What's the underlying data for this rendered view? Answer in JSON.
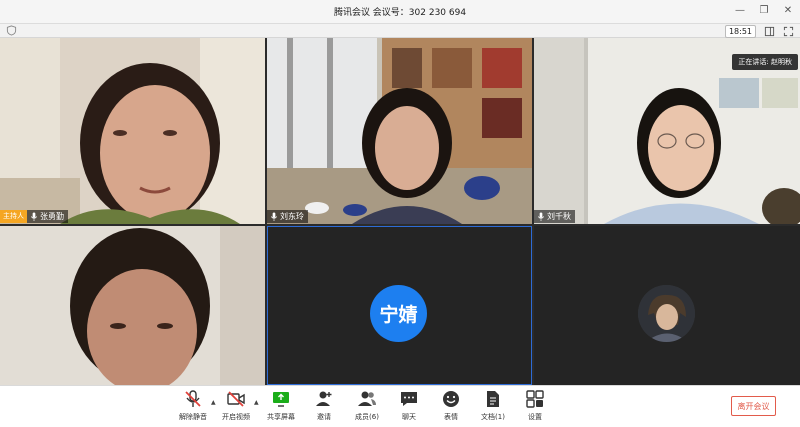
{
  "window": {
    "title": "腾讯会议 会议号：302 230 694"
  },
  "subbar": {
    "time": "18:51"
  },
  "participants": [
    {
      "name": "张勇勤",
      "role_badge": "主持人"
    },
    {
      "name": "刘东玲"
    },
    {
      "name": "刘千秋",
      "speaking_label": "正在讲话: 赵明秋"
    },
    {
      "name": ""
    },
    {
      "avatar_text": "宁婧"
    },
    {
      "name": ""
    }
  ],
  "toolbar": {
    "unmute": "解除静音",
    "start_video": "开启视频",
    "share_screen": "共享屏幕",
    "invite": "邀请",
    "members": "成员(6)",
    "chat": "聊天",
    "reactions": "表情",
    "docs": "文档(1)",
    "settings": "设置",
    "leave": "离开会议"
  },
  "colors": {
    "accent_blue": "#1d7ff0",
    "host_badge": "#f5a623",
    "leave_red": "#e25b4b",
    "muted_red": "#e0413a",
    "share_green": "#1aad19"
  }
}
